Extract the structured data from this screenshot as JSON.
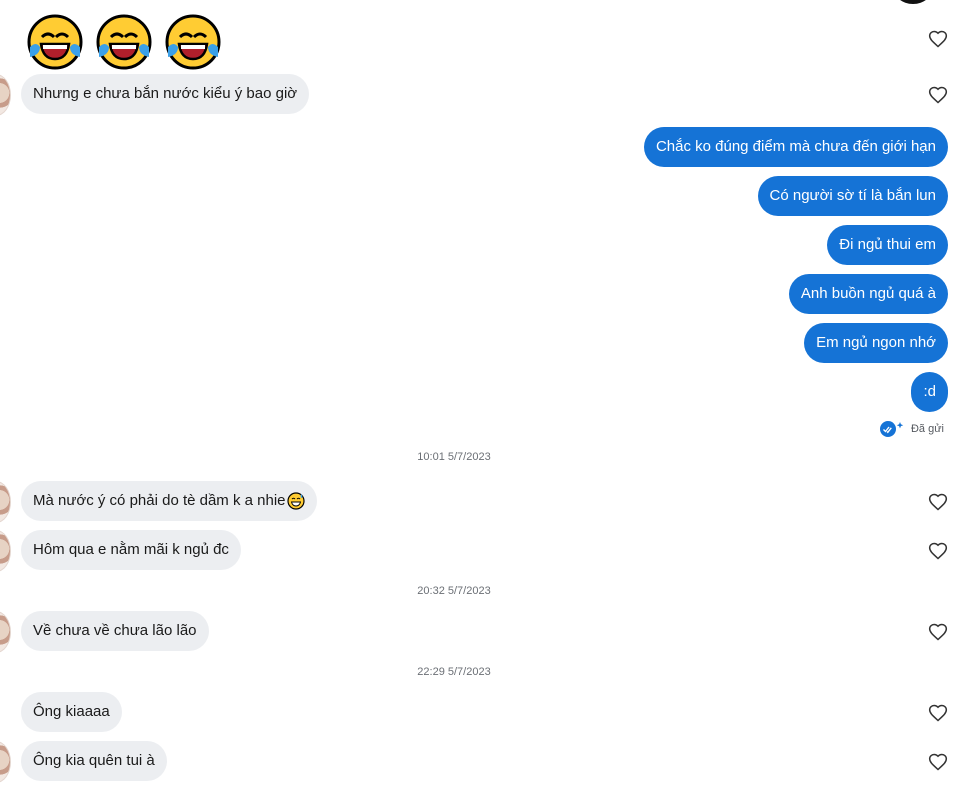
{
  "messages": {
    "emoji_row": [
      "face-with-tears-of-joy",
      "face-with-tears-of-joy",
      "face-with-tears-of-joy"
    ],
    "in_1": "Nhưng e chưa bắn nước kiểu ý bao giờ",
    "out_1": "Chắc ko đúng điểm mà chưa đến giới hạn",
    "out_2": "Có người sờ tí là bắn lun",
    "out_3": "Đi ngủ thui em",
    "out_4": "Anh buồn ngủ quá à",
    "out_5": "Em ngủ ngon nhớ",
    "out_6": ":d",
    "sent_label": "Đã gửi",
    "time_1": "10:01 5/7/2023",
    "in_2": "Mà nước ý có phải do tè dầm k a nhie",
    "in_2_emoji": "grinning-face-with-sweat",
    "in_3": "Hôm qua e nằm mãi k ngủ đc",
    "time_2": "20:32 5/7/2023",
    "in_4": "Về chưa về chưa lão lão",
    "time_3": "22:29 5/7/2023",
    "in_5": "Ông kiaaaa",
    "in_6": "Ông kia quên tui à"
  },
  "colors": {
    "outgoing_bubble": "#1573d6",
    "incoming_bubble": "#eceef1",
    "timestamp_text": "#6b6f75"
  },
  "icons": {
    "like": "heart-outline-icon",
    "sent": "double-check-icon"
  }
}
